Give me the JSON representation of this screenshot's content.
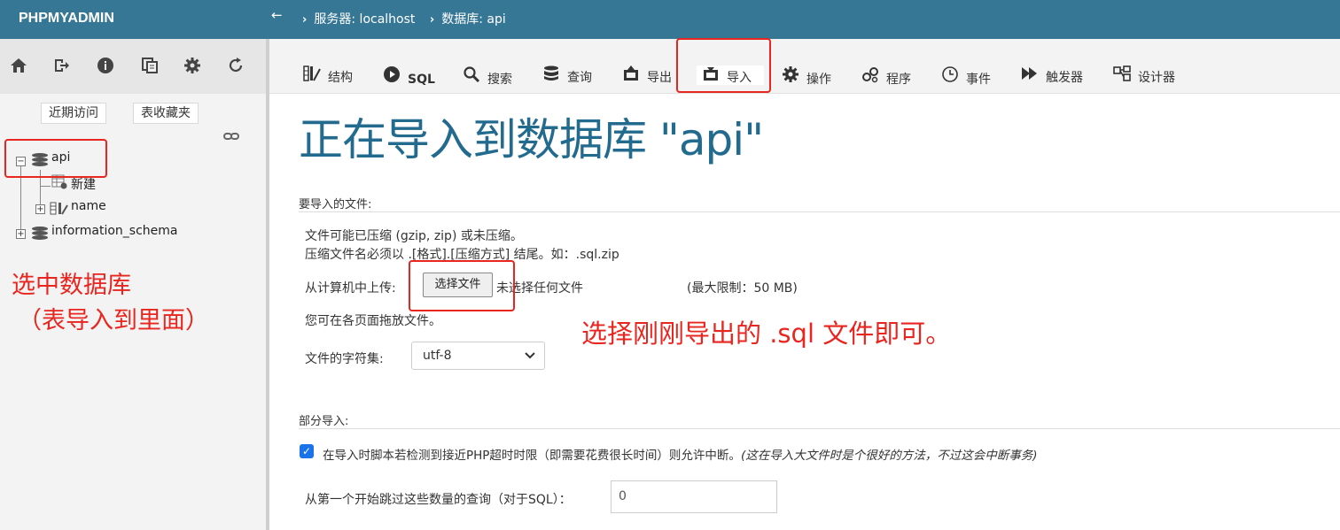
{
  "app": {
    "logo": "PHPMYADMIN"
  },
  "breadcrumb": {
    "back_icon": "←",
    "server": "服务器: localhost",
    "database": "数据库: api"
  },
  "nav": {
    "icons": [
      "home-icon",
      "logout-icon",
      "info-icon",
      "copy-icon",
      "gear-icon",
      "reload-icon"
    ],
    "tabs": [
      "近期访问",
      "表收藏夹"
    ]
  },
  "tree": {
    "db_api": "api",
    "new_item": "新建",
    "table_name": "name",
    "db_information_schema": "information_schema"
  },
  "annotations": {
    "select_db_line1": "选中数据库",
    "select_db_line2": "（表导入到里面）",
    "choose_file_note": "选择刚刚导出的 .sql 文件即可。"
  },
  "tabs": {
    "structure": "结构",
    "sql": "SQL",
    "search": "搜索",
    "query": "查询",
    "export": "导出",
    "import": "导入",
    "operations": "操作",
    "routines": "程序",
    "events": "事件",
    "triggers": "触发器",
    "designer": "设计器"
  },
  "main": {
    "heading": "正在导入到数据库 \"api\"",
    "file_section_title": "要导入的文件:",
    "compress_note_1": "文件可能已压缩 (gzip, zip) 或未压缩。",
    "compress_note_2": "压缩文件名必须以 .[格式].[压缩方式] 结尾。如：.sql.zip",
    "upload_label": "从计算机中上传:",
    "choose_file_button": "选择文件",
    "no_file_text": "未选择任何文件",
    "max_limit": "(最大限制：50 MB)",
    "drag_note": "您可在各页面拖放文件。",
    "charset_label": "文件的字符集:",
    "charset_value": "utf-8",
    "partial_section_title": "部分导入:",
    "interrupt_label": "在导入时脚本若检测到接近PHP超时时限（即需要花费很长时间）则允许中断。",
    "interrupt_note": "(这在导入大文件时是个很好的方法，不过这会中断事务)",
    "interrupt_checked": true,
    "skip_label": "从第一个开始跳过这些数量的查询（对于SQL）：",
    "skip_value": "0"
  },
  "colors": {
    "topbar": "#377796",
    "heading": "#236b8e",
    "annotation": "#e8251f",
    "checkbox": "#1a73e8"
  }
}
